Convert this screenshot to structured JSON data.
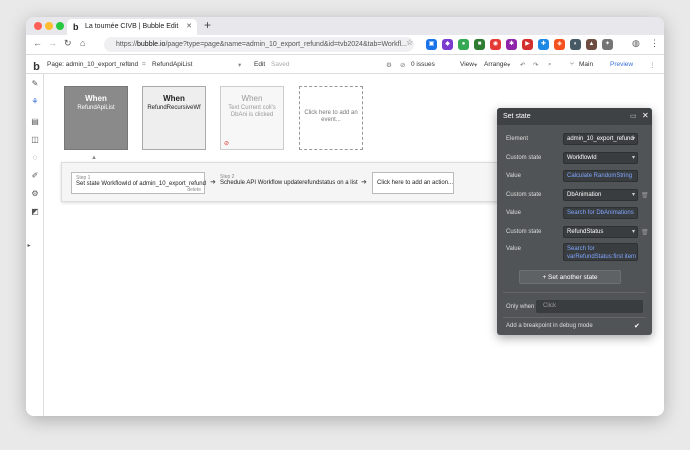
{
  "browser": {
    "tab_title": "La tournée CIVB | Bubble Edit",
    "tab_favicon": "bubble-b-icon",
    "url_prefix": "https://",
    "url_domain": "bubble.io",
    "url_rest": "/page?type=page&name=admin_10_export_refund&id=tvb2024&tab=Workfl..."
  },
  "editor": {
    "page_label": "Page: admin_10_export_refund",
    "context": "RefundApiList",
    "menu_edit": "Edit",
    "saved_status": "Saved",
    "issues": "0 issues",
    "view": "View",
    "arrange": "Arrange",
    "branch": "Main",
    "preview": "Preview"
  },
  "events": [
    {
      "when": "When",
      "name": "RefundApiList"
    },
    {
      "when": "When",
      "name": "RefundRecursiveWf"
    },
    {
      "when": "When",
      "name": "Text Current coll's DbAni is clicked"
    },
    {
      "add": "Click here to add an event..."
    }
  ],
  "actions": {
    "step1_label": "Step 1",
    "step1_text": "Set state WorkflowId of admin_10_export_refund",
    "step1_delete": "delete",
    "step2_label": "Step 2",
    "step2_text": "Schedule API Workflow updaterefundstatus on a list",
    "add_action": "Click here to add an action..."
  },
  "panel": {
    "title": "Set state",
    "element_label": "Element",
    "element_value": "admin_10_export_refund",
    "states": [
      {
        "label": "Custom state",
        "name": "WorkflowId",
        "value_label": "Value",
        "value": "Calculate RandomString"
      },
      {
        "label": "Custom state",
        "name": "DbAnimation",
        "value_label": "Value",
        "value": "Search for DbAnimations"
      },
      {
        "label": "Custom state",
        "name": "RefundStatus",
        "value_label": "Value",
        "value": "Search for varRefundStatus:first item"
      }
    ],
    "add_state": "Set another state",
    "only_when_label": "Only when",
    "only_when_placeholder": "Click",
    "breakpoint_label": "Add a breakpoint in debug mode"
  },
  "colors": {
    "panel_bg": "#505456",
    "expression": "#7fa6ff",
    "selected_event": "#8a8a8a"
  }
}
